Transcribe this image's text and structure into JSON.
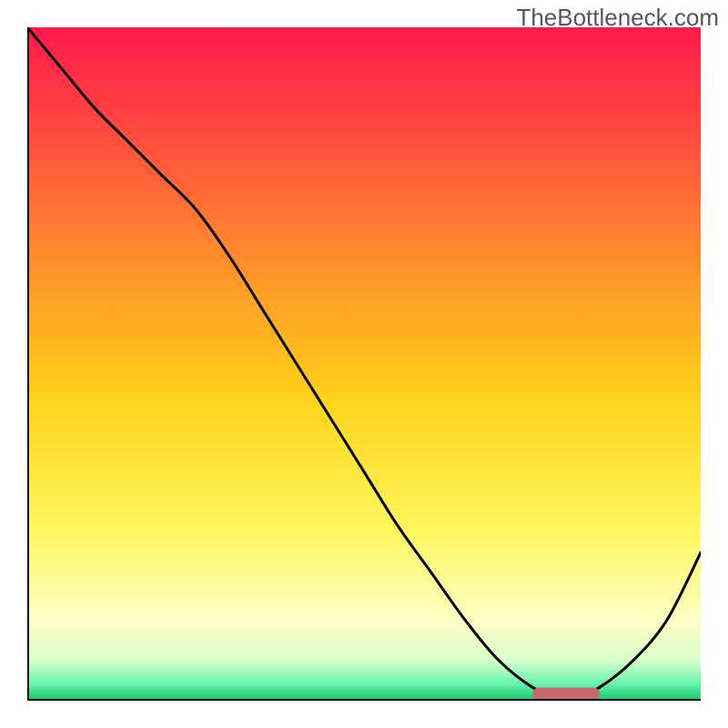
{
  "watermark": "TheBottleneck.com",
  "chart_data": {
    "type": "line",
    "title": "",
    "xlabel": "",
    "ylabel": "",
    "xlim": [
      0,
      100
    ],
    "ylim": [
      0,
      100
    ],
    "grid": false,
    "series": [
      {
        "name": "curve",
        "x": [
          0,
          5,
          10,
          15,
          20,
          25,
          30,
          35,
          40,
          45,
          50,
          55,
          60,
          65,
          70,
          75,
          78,
          82,
          85,
          90,
          95,
          100
        ],
        "y": [
          100,
          94,
          88,
          83,
          78,
          73,
          66,
          58,
          50,
          42,
          34,
          26,
          19,
          12,
          6,
          2,
          1,
          1,
          2,
          6,
          12,
          22
        ]
      }
    ],
    "marker_band": {
      "x_start": 75,
      "x_end": 85,
      "y": 1,
      "color": "#c86a6d"
    },
    "gradient_stops": [
      {
        "pos": 0.0,
        "color": "#ff1a4b"
      },
      {
        "pos": 0.15,
        "color": "#ff4840"
      },
      {
        "pos": 0.35,
        "color": "#ff8f2b"
      },
      {
        "pos": 0.55,
        "color": "#ffd21a"
      },
      {
        "pos": 0.75,
        "color": "#fff760"
      },
      {
        "pos": 0.88,
        "color": "#feffc5"
      },
      {
        "pos": 0.94,
        "color": "#d8ffca"
      },
      {
        "pos": 0.975,
        "color": "#69f3b0"
      },
      {
        "pos": 1.0,
        "color": "#12c86a"
      }
    ],
    "axis_color": "#000000",
    "curve_color": "#000000",
    "curve_width": 3
  }
}
